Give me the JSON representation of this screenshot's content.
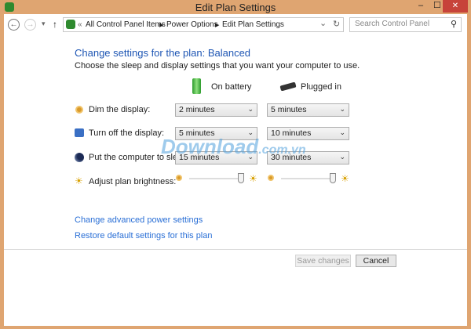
{
  "window": {
    "title": "Edit Plan Settings",
    "minimize": "–",
    "maximize": "☐",
    "close": "✕"
  },
  "nav": {
    "back": "←",
    "forward": "→",
    "recent": "▾",
    "up": "↑",
    "sep": "«",
    "breadcrumb": [
      "All Control Panel Items",
      "Power Options",
      "Edit Plan Settings"
    ],
    "address_dropdown": "⌄",
    "refresh": "↻",
    "search_placeholder": "Search Control Panel",
    "search_icon": "⚲"
  },
  "main": {
    "heading": "Change settings for the plan: Balanced",
    "subtitle": "Choose the sleep and display settings that you want your computer to use.",
    "columns": [
      "On battery",
      "Plugged in"
    ],
    "rows": [
      {
        "label": "Dim the display:",
        "battery": "2 minutes",
        "plugged": "5 minutes"
      },
      {
        "label": "Turn off the display:",
        "battery": "5 minutes",
        "plugged": "10 minutes"
      },
      {
        "label": "Put the computer to sleep:",
        "battery": "15 minutes",
        "plugged": "30 minutes"
      }
    ],
    "brightness": {
      "label": "Adjust plan brightness:",
      "battery_percent": 100,
      "plugged_percent": 100
    },
    "links": [
      "Change advanced power settings",
      "Restore default settings for this plan"
    ]
  },
  "buttons": {
    "save": "Save changes",
    "cancel": "Cancel"
  },
  "watermark": "Download.com.vn"
}
